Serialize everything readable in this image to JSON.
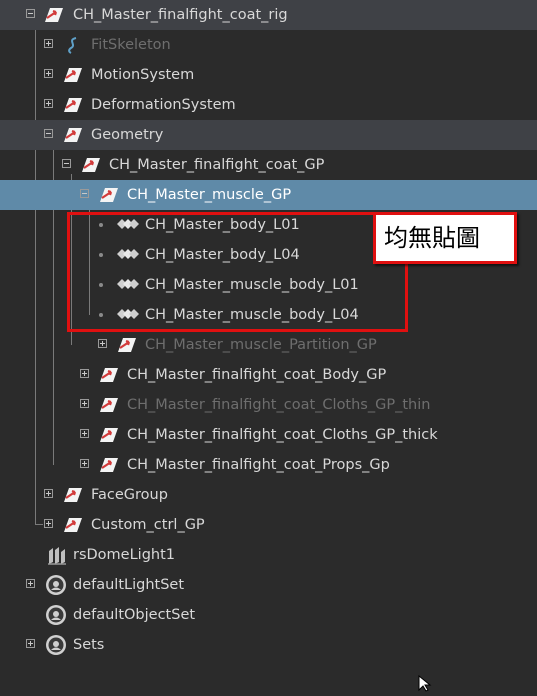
{
  "outliner": {
    "rows": [
      {
        "label": "CH_Master_finalfight_coat_rig",
        "icon": "transform-group-icon",
        "expander": "minus",
        "state": "highlight"
      },
      {
        "label": "FitSkeleton",
        "icon": "curve-s-icon",
        "expander": "plus",
        "state": "dim"
      },
      {
        "label": "MotionSystem",
        "icon": "transform-group-icon",
        "expander": "plus",
        "state": "normal"
      },
      {
        "label": "DeformationSystem",
        "icon": "transform-group-icon",
        "expander": "plus",
        "state": "normal"
      },
      {
        "label": "Geometry",
        "icon": "transform-group-icon",
        "expander": "minus",
        "state": "highlight"
      },
      {
        "label": "CH_Master_finalfight_coat_GP",
        "icon": "transform-group-icon",
        "expander": "minus",
        "state": "normal"
      },
      {
        "label": "CH_Master_muscle_GP",
        "icon": "transform-group-icon",
        "expander": "minus",
        "state": "selected"
      },
      {
        "label": "CH_Master_body_L01",
        "icon": "mesh-icon",
        "expander": "none",
        "state": "normal"
      },
      {
        "label": "CH_Master_body_L04",
        "icon": "mesh-icon",
        "expander": "none",
        "state": "normal"
      },
      {
        "label": "CH_Master_muscle_body_L01",
        "icon": "mesh-icon",
        "expander": "none",
        "state": "normal"
      },
      {
        "label": "CH_Master_muscle_body_L04",
        "icon": "mesh-icon",
        "expander": "none",
        "state": "normal"
      },
      {
        "label": "CH_Master_muscle_Partition_GP",
        "icon": "transform-group-icon",
        "expander": "plus",
        "state": "dim"
      },
      {
        "label": "CH_Master_finalfight_coat_Body_GP",
        "icon": "transform-group-icon",
        "expander": "plus",
        "state": "normal"
      },
      {
        "label": "CH_Master_finalfight_coat_Cloths_GP_thin",
        "icon": "transform-group-icon",
        "expander": "plus",
        "state": "dim"
      },
      {
        "label": "CH_Master_finalfight_coat_Cloths_GP_thick",
        "icon": "transform-group-icon",
        "expander": "plus",
        "state": "normal"
      },
      {
        "label": "CH_Master_finalfight_coat_Props_Gp",
        "icon": "transform-group-icon",
        "expander": "plus",
        "state": "normal"
      },
      {
        "label": "FaceGroup",
        "icon": "transform-group-icon",
        "expander": "plus",
        "state": "normal"
      },
      {
        "label": "Custom_ctrl_GP",
        "icon": "transform-group-icon",
        "expander": "plus",
        "state": "normal"
      },
      {
        "label": "rsDomeLight1",
        "icon": "dome-light-icon",
        "expander": "none",
        "state": "normal"
      },
      {
        "label": "defaultLightSet",
        "icon": "set-icon",
        "expander": "plus",
        "state": "normal"
      },
      {
        "label": "defaultObjectSet",
        "icon": "set-icon",
        "expander": "none",
        "state": "normal"
      },
      {
        "label": "Sets",
        "icon": "set-icon",
        "expander": "plus",
        "state": "normal"
      }
    ]
  },
  "annotation": {
    "text": "均無貼圖",
    "color": "#e01010"
  },
  "colors": {
    "background": "#2b2b2b",
    "selected": "#5f8aa8",
    "highlight": "#3f4146",
    "group_icon_red": "#d23b3b"
  }
}
